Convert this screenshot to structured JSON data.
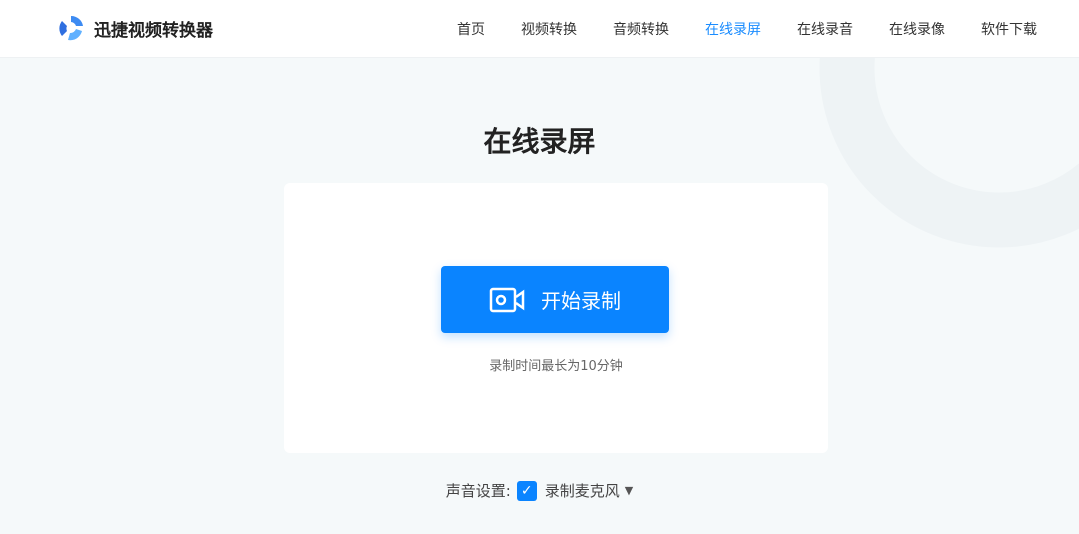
{
  "header": {
    "brand": "迅捷视频转换器",
    "nav": [
      {
        "label": "首页"
      },
      {
        "label": "视频转换"
      },
      {
        "label": "音频转换"
      },
      {
        "label": "在线录屏"
      },
      {
        "label": "在线录音"
      },
      {
        "label": "在线录像"
      },
      {
        "label": "软件下载"
      }
    ],
    "active": "在线录屏"
  },
  "main": {
    "title": "在线录屏",
    "record_button": "开始录制",
    "hint": "录制时间最长为10分钟"
  },
  "sound": {
    "label": "声音设置:",
    "checked": true,
    "option": "录制麦克风"
  },
  "colors": {
    "accent": "#0a84ff",
    "nav_active": "#1a8cff"
  }
}
